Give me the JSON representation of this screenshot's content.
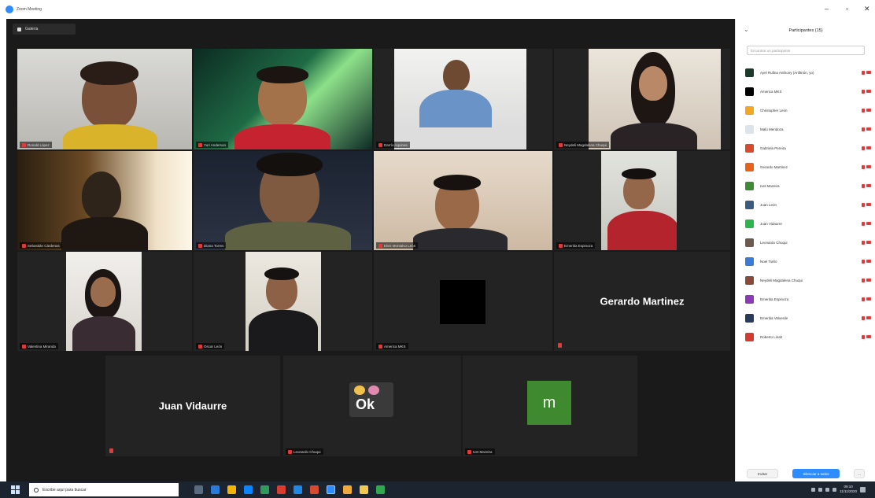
{
  "window": {
    "title": "Zoom Meeting",
    "controls": {
      "minimize": "–",
      "maximize": "▫",
      "close": "✕"
    }
  },
  "meeting": {
    "view_label": "Galería",
    "tiles": [
      {
        "name": "Ronald López"
      },
      {
        "name": "Yuri Anderson"
      },
      {
        "name": "Darrío Aquinas"
      },
      {
        "name": "Neydeli Magdalena Chuqui"
      },
      {
        "name": "Sebastián Cárdenas"
      },
      {
        "name": "Diana Torres"
      },
      {
        "name": "Elvis Montalvo León"
      },
      {
        "name": "Emeritia Espinoza"
      },
      {
        "name": "Valentina Miranda"
      },
      {
        "name": "Oscar León"
      },
      {
        "name": "America MKS"
      },
      {
        "name": "Gerardo Martinez",
        "big": "Gerardo Martinez"
      },
      {
        "name": "Juan Vidaurre",
        "big": "Juan Vidaurre"
      },
      {
        "name": "Leonardo Chuqui",
        "ok_text": "Ok"
      },
      {
        "name": "Ivet Mazeira",
        "initial": "m"
      }
    ]
  },
  "panel": {
    "title": "Participantes (15)",
    "search_placeholder": "Encontrar un participante",
    "participants": [
      {
        "name": "Ayel Rufina Anthony (Anfitrión, yo)",
        "color": "#1a3a2a"
      },
      {
        "name": "America MKS",
        "color": "#000000"
      },
      {
        "name": "Christopher León",
        "color": "#f5a623"
      },
      {
        "name": "Malú Mendoza",
        "color": "#dde3ea"
      },
      {
        "name": "Gabriela Pereira",
        "color": "#d84a2e"
      },
      {
        "name": "Gerardo Martinez",
        "color": "#e8621c"
      },
      {
        "name": "Ivet Mazeira",
        "color": "#3d8b37"
      },
      {
        "name": "Juan León",
        "color": "#3a5a80"
      },
      {
        "name": "Juan Vidaurre",
        "color": "#2bb54a"
      },
      {
        "name": "Leonardo Chuqui",
        "color": "#6b5a4d"
      },
      {
        "name": "Noel Tiaño",
        "color": "#3a7bd5"
      },
      {
        "name": "Neydeli Magdalena Chuqui",
        "color": "#8a4a3a"
      },
      {
        "name": "Emeritia Espinoza",
        "color": "#8a3ab5"
      },
      {
        "name": "Emeritia Valverde",
        "color": "#2a3a5a"
      },
      {
        "name": "Roberto Linah",
        "color": "#d43a2e"
      }
    ],
    "invite_label": "Invitar",
    "mute_all_label": "Silenciar a todos",
    "more_label": "..."
  },
  "taskbar": {
    "search_placeholder": "Escribe aquí para buscar",
    "clock_time": "09:10",
    "clock_date": "11/11/2020"
  }
}
